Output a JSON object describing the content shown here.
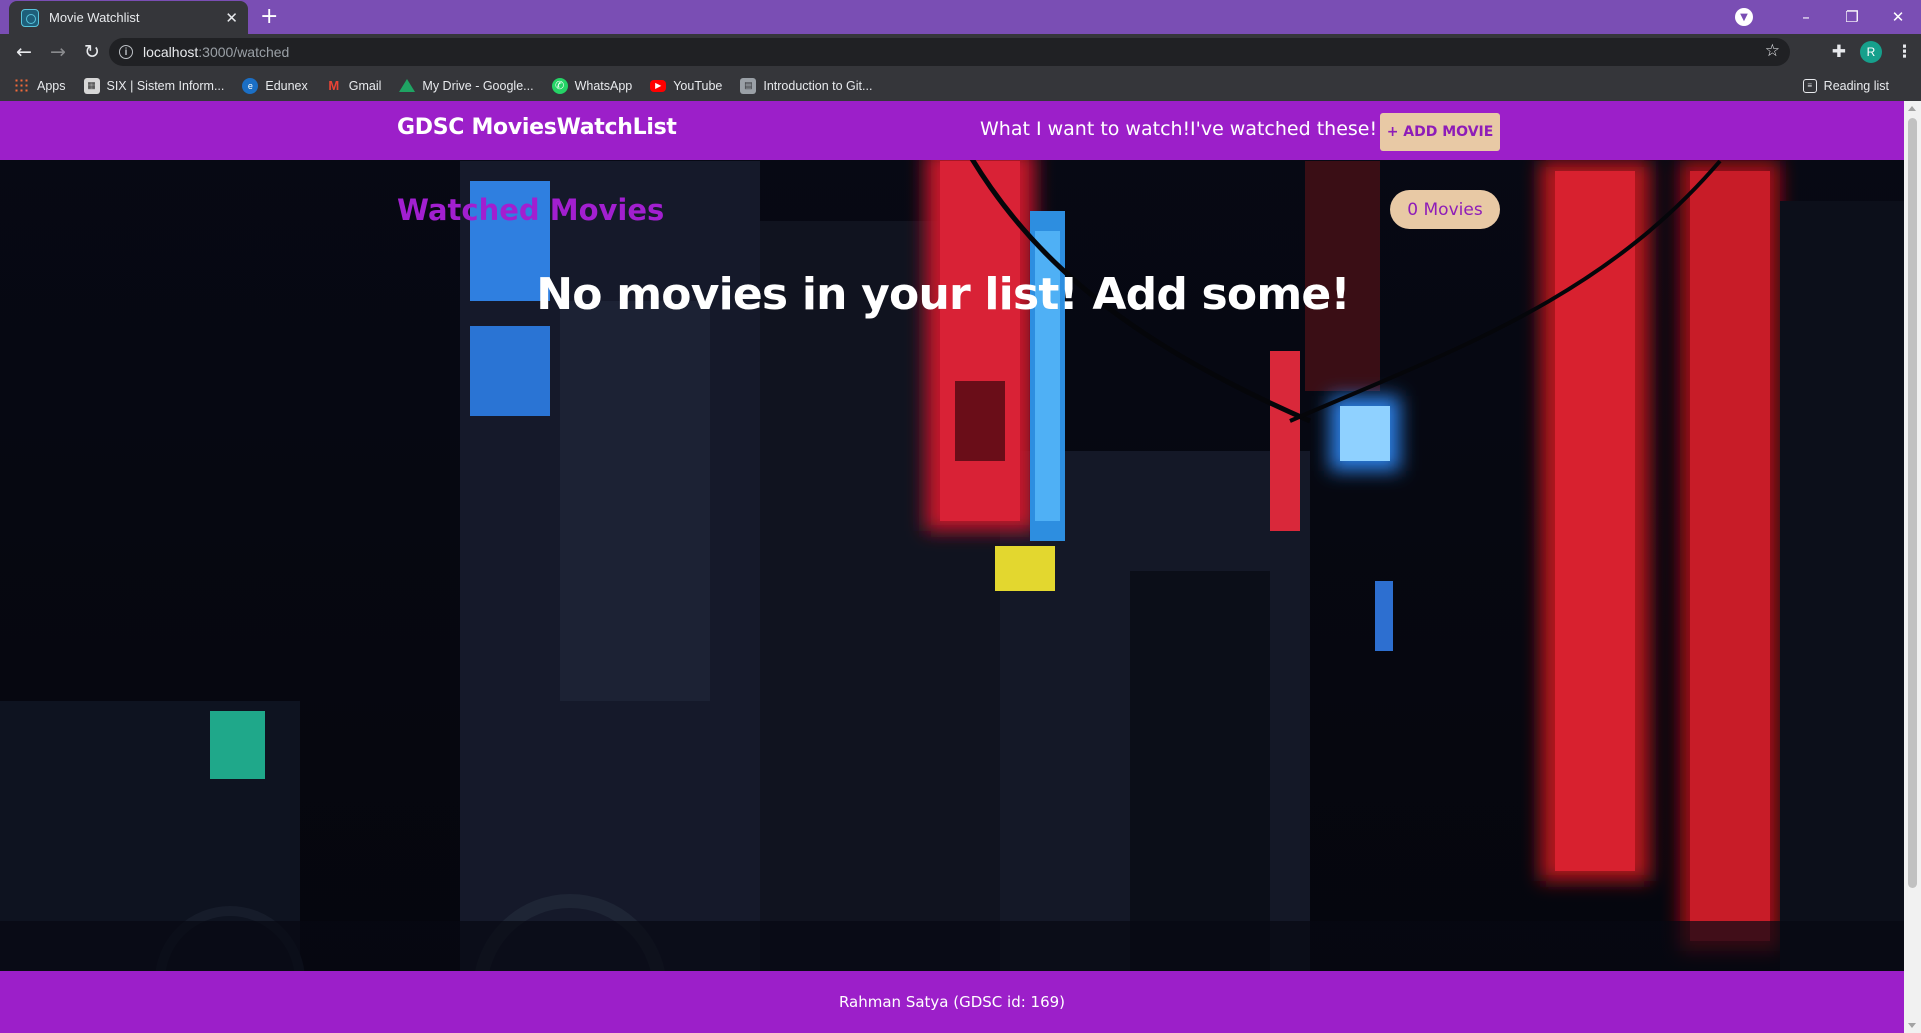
{
  "browser": {
    "tab_title": "Movie Watchlist",
    "url_host": "localhost",
    "url_path": ":3000/watched",
    "bookmarks": [
      {
        "label": "Apps",
        "icon": "apps-grid-icon"
      },
      {
        "label": "SIX | Sistem Inform...",
        "icon": "six-icon"
      },
      {
        "label": "Edunex",
        "icon": "edunex-icon"
      },
      {
        "label": "Gmail",
        "icon": "gmail-icon"
      },
      {
        "label": "My Drive - Google...",
        "icon": "google-drive-icon"
      },
      {
        "label": "WhatsApp",
        "icon": "whatsapp-icon"
      },
      {
        "label": "YouTube",
        "icon": "youtube-icon"
      },
      {
        "label": "Introduction to Git...",
        "icon": "page-icon"
      }
    ],
    "reading_list": "Reading list",
    "profile_initial": "R"
  },
  "header": {
    "brand": "GDSC MoviesWatchList",
    "nav_want": "What I want to watch!",
    "nav_watched": "I've watched these!",
    "add_button": "+ ADD MOVIE"
  },
  "main": {
    "title": "Watched Movies",
    "count": "0 Movies",
    "empty_message": "No movies in your list! Add some!"
  },
  "footer": {
    "text": "Rahman Satya (GDSC id: 169)"
  },
  "colors": {
    "header_bg": "#9c1fc9",
    "accent_button": "#e8c9a5",
    "title_purple": "#a21fd0",
    "chrome_titlebar": "#7a4eb4"
  }
}
